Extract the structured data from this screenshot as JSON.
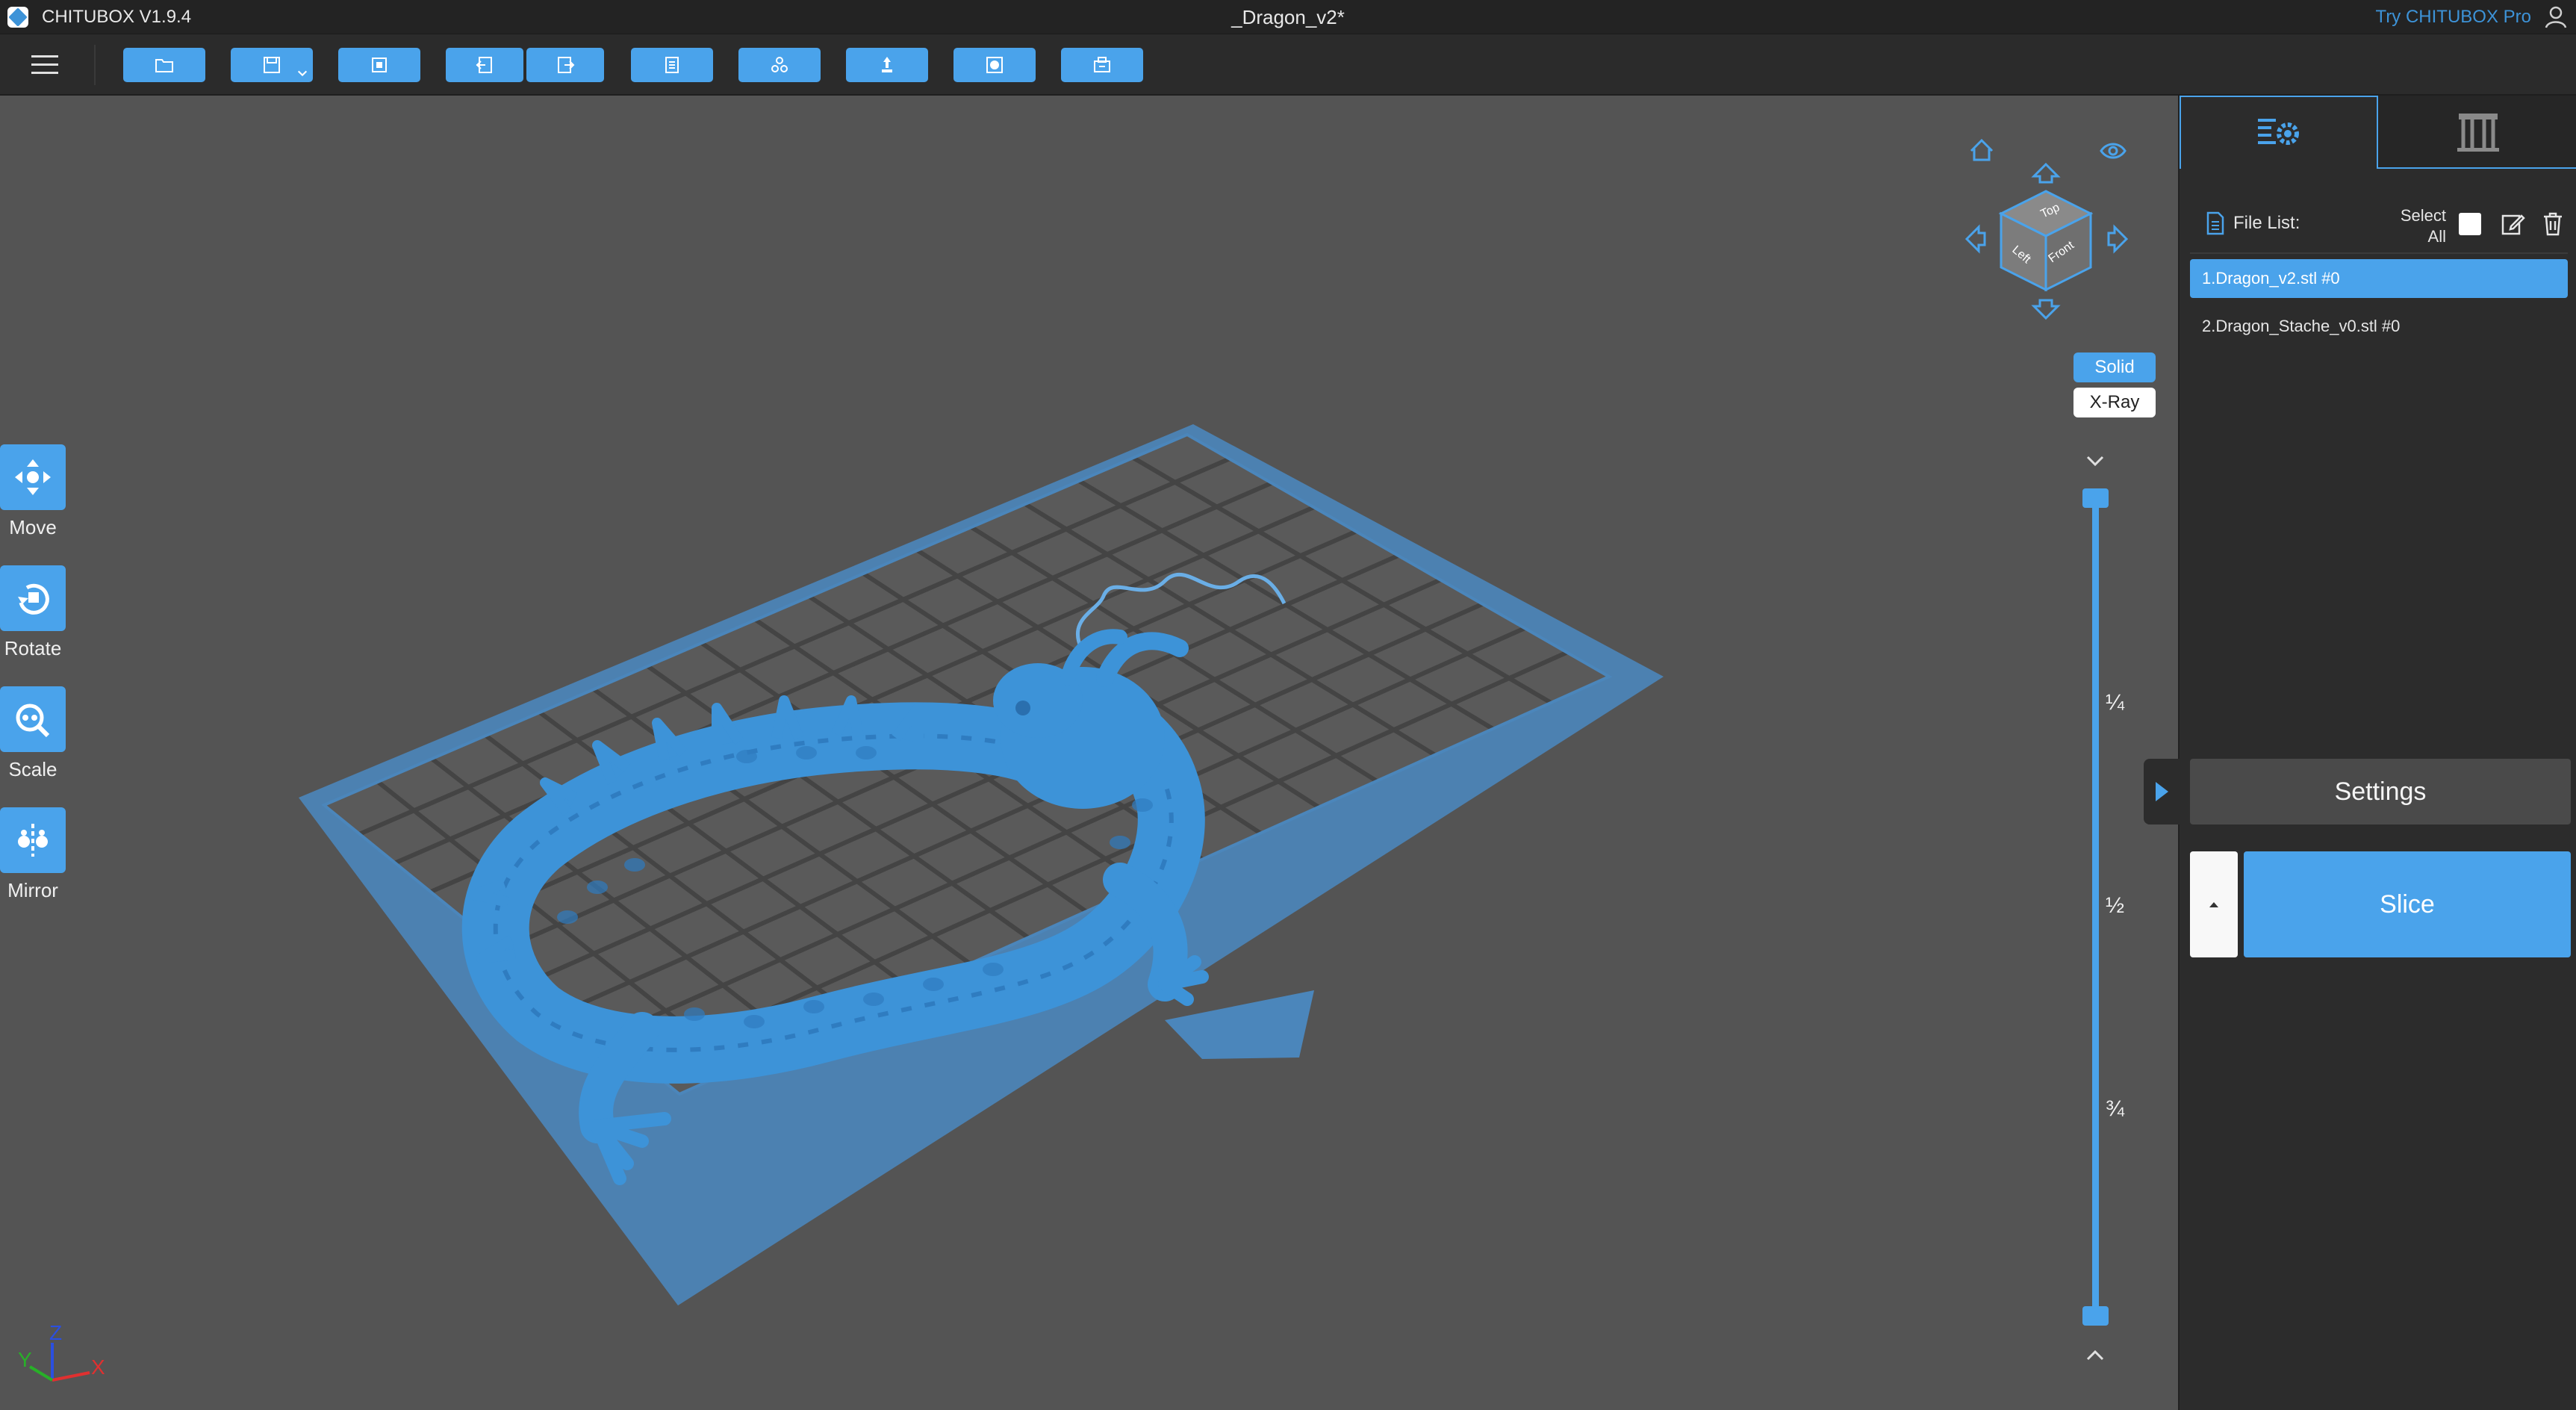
{
  "titlebar": {
    "app_name": "CHITUBOX V1.9.4",
    "document_title": "_Dragon_v2*",
    "pro_link": "Try CHITUBOX Pro"
  },
  "toolbar": {
    "buttons": [
      "open-folder-icon",
      "save-icon",
      "new-file-icon",
      "import-icon",
      "export-icon",
      "file-info-icon",
      "settings-icon",
      "upload-icon",
      "layer-icon",
      "printer-icon"
    ]
  },
  "left_tools": [
    {
      "label": "Move",
      "icon": "move-icon"
    },
    {
      "label": "Rotate",
      "icon": "rotate-icon"
    },
    {
      "label": "Scale",
      "icon": "scale-icon"
    },
    {
      "label": "Mirror",
      "icon": "mirror-icon"
    }
  ],
  "view_cube": {
    "faces": {
      "top": "Top",
      "left": "Left",
      "front": "Front"
    }
  },
  "render_modes": {
    "solid": "Solid",
    "xray": "X-Ray",
    "active": "Solid"
  },
  "layer_slider": {
    "marks": [
      "¼",
      "½",
      "¾"
    ]
  },
  "axes": {
    "x": "X",
    "y": "Y",
    "z": "Z"
  },
  "right_panel": {
    "tabs": [
      "file-list-settings-icon",
      "support-icon"
    ],
    "file_list_label": "File List:",
    "select_all_label": "Select All",
    "select_all_line1": "Select",
    "select_all_line2": "All",
    "files": [
      {
        "name": "1.Dragon_v2.stl #0",
        "selected": true
      },
      {
        "name": "2.Dragon_Stache_v0.stl #0",
        "selected": false
      }
    ],
    "settings_label": "Settings",
    "slice_label": "Slice"
  },
  "colors": {
    "accent": "#4aa3eb",
    "model": "#3d93d8",
    "background": "#545454",
    "panel": "#2c2c2c"
  }
}
